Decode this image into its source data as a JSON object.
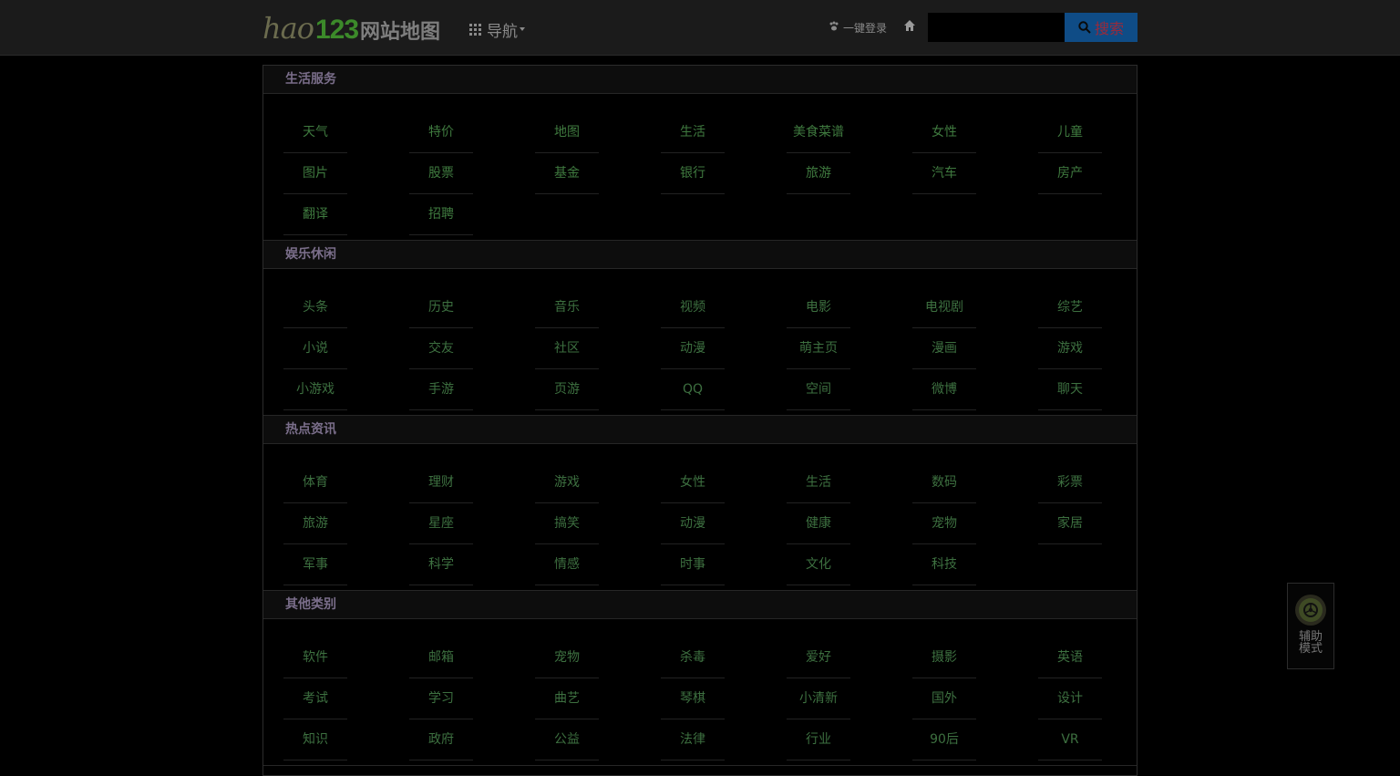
{
  "header": {
    "logo_hao": "hao",
    "logo_123": "123",
    "logo_sub": "网站地图",
    "nav_label": "导航",
    "login_label": "一键登录",
    "search_placeholder": "",
    "search_button": "搜索"
  },
  "sections": [
    {
      "title": "生活服务",
      "links": [
        "天气",
        "特价",
        "地图",
        "生活",
        "美食菜谱",
        "女性",
        "儿童",
        "图片",
        "股票",
        "基金",
        "银行",
        "旅游",
        "汽车",
        "房产",
        "翻译",
        "招聘"
      ]
    },
    {
      "title": "娱乐休闲",
      "links": [
        "头条",
        "历史",
        "音乐",
        "视频",
        "电影",
        "电视剧",
        "综艺",
        "小说",
        "交友",
        "社区",
        "动漫",
        "萌主页",
        "漫画",
        "游戏",
        "小游戏",
        "手游",
        "页游",
        "QQ",
        "空间",
        "微博",
        "聊天"
      ]
    },
    {
      "title": "热点资讯",
      "links": [
        "体育",
        "理财",
        "游戏",
        "女性",
        "生活",
        "数码",
        "彩票",
        "旅游",
        "星座",
        "搞笑",
        "动漫",
        "健康",
        "宠物",
        "家居",
        "军事",
        "科学",
        "情感",
        "时事",
        "文化",
        "科技"
      ]
    },
    {
      "title": "其他类别",
      "links": [
        "软件",
        "邮箱",
        "宠物",
        "杀毒",
        "爱好",
        "摄影",
        "英语",
        "考试",
        "学习",
        "曲艺",
        "琴棋",
        "小清新",
        "国外",
        "设计",
        "知识",
        "政府",
        "公益",
        "法律",
        "行业",
        "90后",
        "VR"
      ]
    }
  ],
  "assist": {
    "label": "辅助模式",
    "icon": "wheel-icon"
  }
}
